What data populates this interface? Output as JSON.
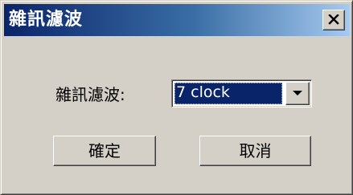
{
  "window": {
    "title": "雜訊濾波"
  },
  "form": {
    "label": "雜訊濾波:",
    "selected_value": "7 clock"
  },
  "buttons": {
    "ok_label": "確定",
    "cancel_label": "取消"
  },
  "icons": {
    "close": "close-icon",
    "dropdown": "chevron-down-icon"
  },
  "colors": {
    "titlebar_start": "#0a246a",
    "titlebar_end": "#a6caf0",
    "dialog_face": "#d4d0c8",
    "selection": "#0a246a"
  }
}
